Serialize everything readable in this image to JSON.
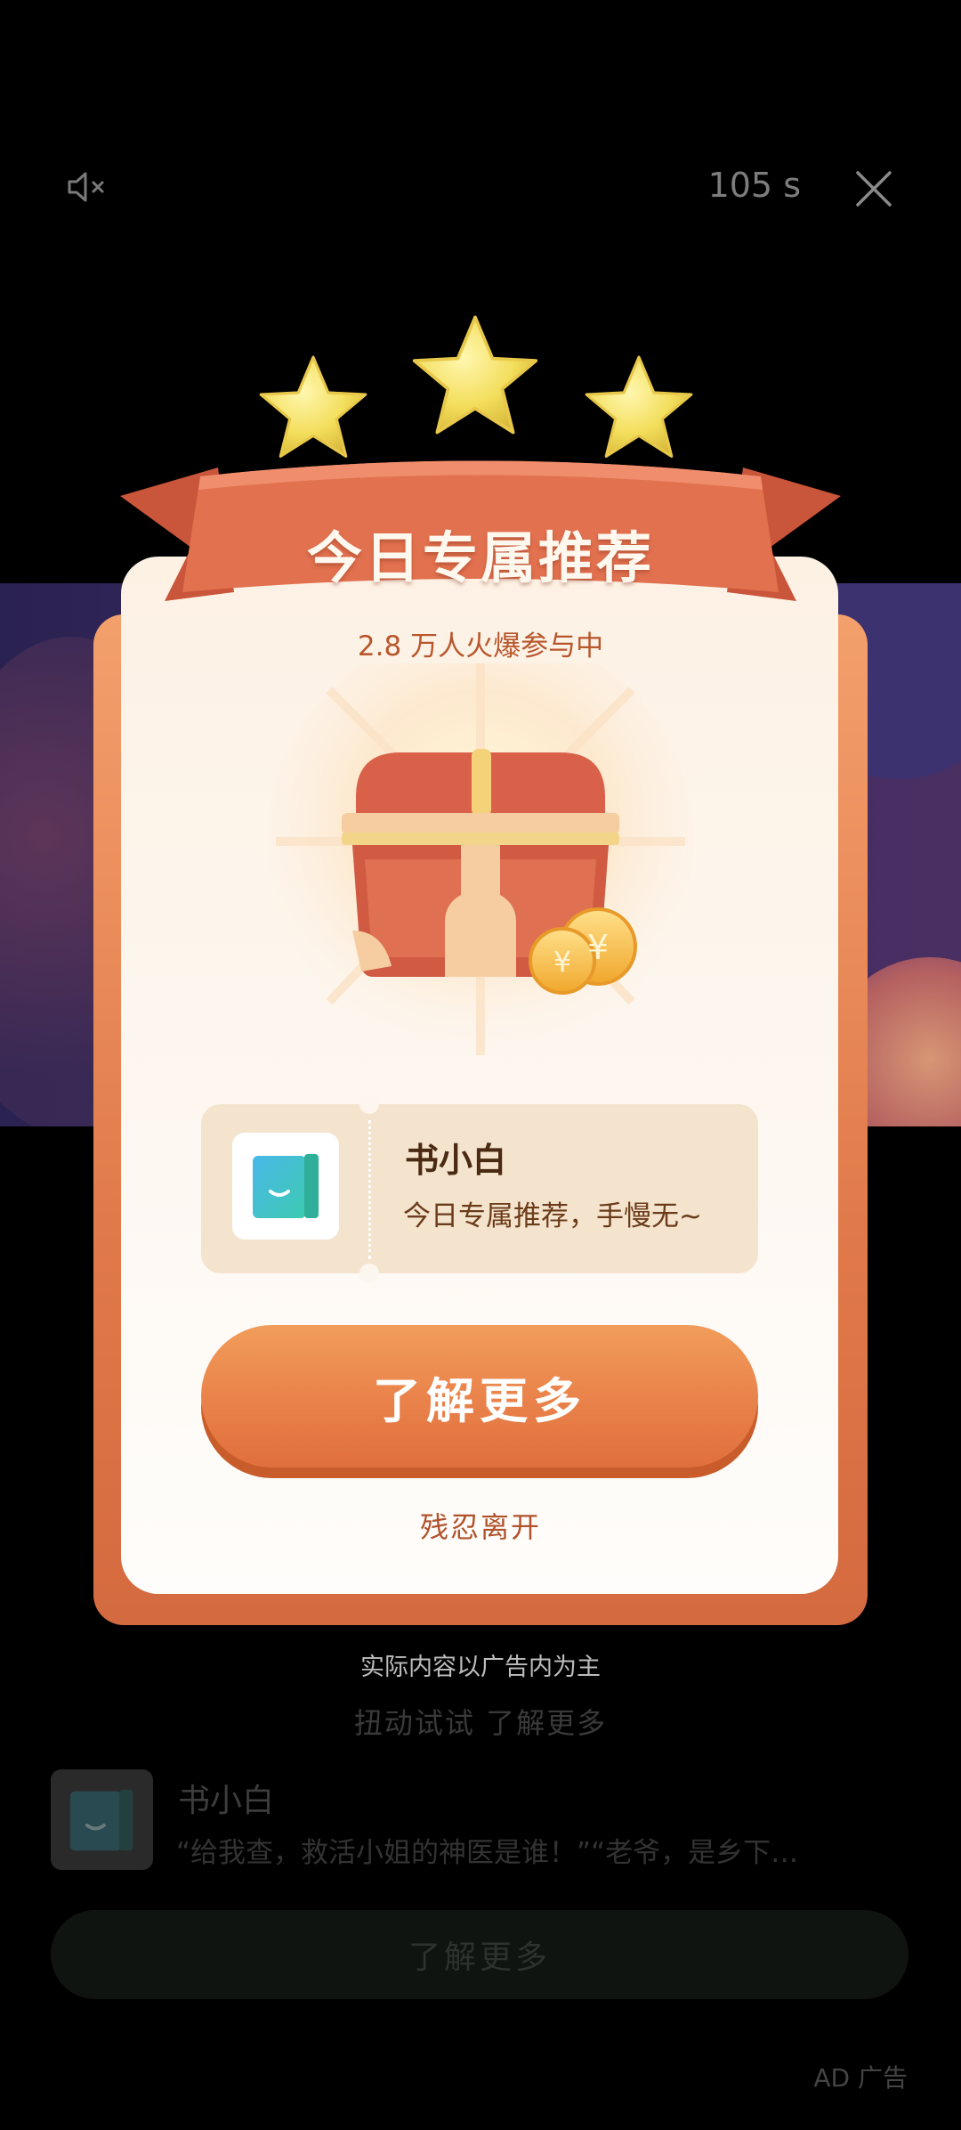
{
  "top_bar": {
    "timer": "105 s",
    "mute_icon": "speaker-muted-icon",
    "close_icon": "close-icon"
  },
  "popup": {
    "ribbon_title": "今日专属推荐",
    "subtitle": "2.8 万人火爆参与中",
    "app_name": "书小白",
    "app_desc": "今日专属推荐，手慢无~",
    "cta_label": "了解更多",
    "leave_label": "残忍离开"
  },
  "footer": {
    "disclaimer": "实际内容以广告内为主",
    "shake_hint": "扭动试试 了解更多",
    "ad_title": "书小白",
    "ad_desc": "“给我查，救活小姐的神医是谁！”“老爷，是乡下…",
    "ad_button": "了解更多",
    "ad_label": "AD 广告"
  },
  "colors": {
    "accent_orange": "#e9814a",
    "ribbon": "#e2714f",
    "card_bg": "#fdf6ee"
  }
}
